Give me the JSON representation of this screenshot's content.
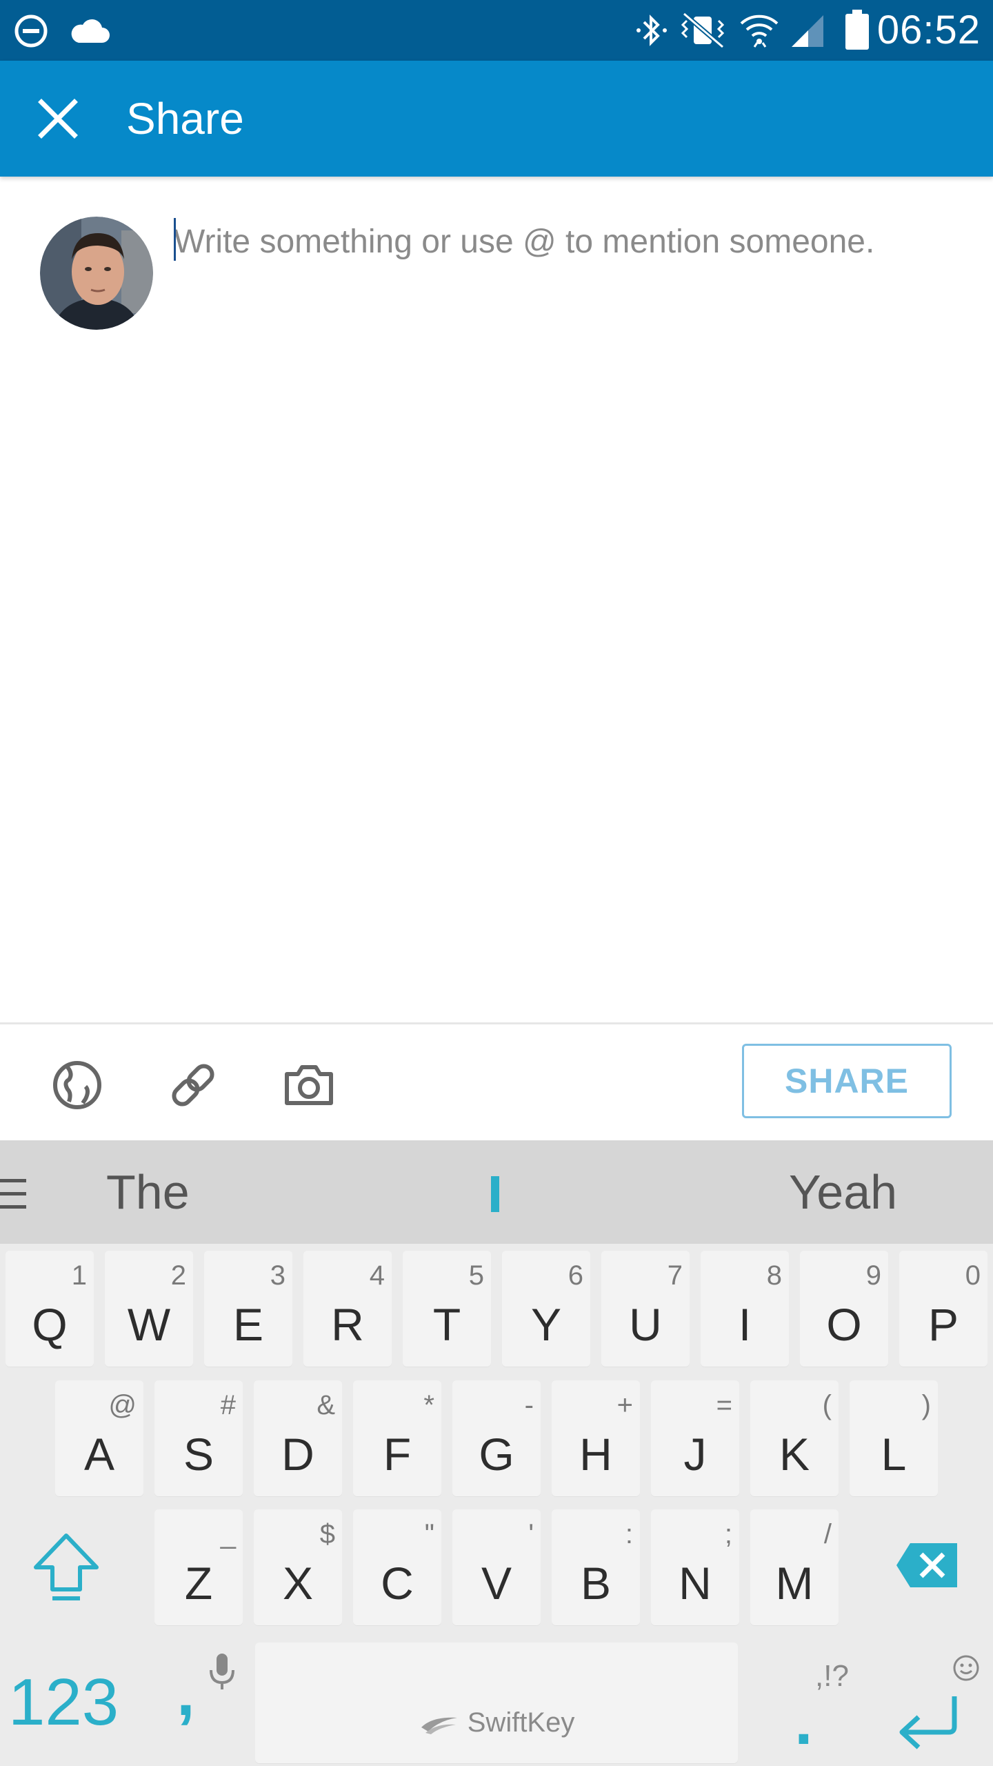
{
  "status_bar": {
    "time": "06:52",
    "left_icons": [
      "do-not-disturb-icon",
      "cloud-icon"
    ],
    "right_icons": [
      "bluetooth-icon",
      "vibrate-mute-icon",
      "wifi-icon",
      "cell-signal-icon",
      "battery-icon"
    ]
  },
  "app_bar": {
    "title": "Share",
    "close_icon": "close-icon",
    "background": "#0689c9"
  },
  "composer": {
    "placeholder": "Write something or use @ to mention someone."
  },
  "toolbar": {
    "icons": [
      "globe-visibility-icon",
      "link-icon",
      "camera-icon"
    ],
    "share_label": "SHARE"
  },
  "keyboard": {
    "suggestions": [
      "The",
      "Yeah"
    ],
    "row1": [
      {
        "main": "Q",
        "sec": "1"
      },
      {
        "main": "W",
        "sec": "2"
      },
      {
        "main": "E",
        "sec": "3"
      },
      {
        "main": "R",
        "sec": "4"
      },
      {
        "main": "T",
        "sec": "5"
      },
      {
        "main": "Y",
        "sec": "6"
      },
      {
        "main": "U",
        "sec": "7"
      },
      {
        "main": "I",
        "sec": "8"
      },
      {
        "main": "O",
        "sec": "9"
      },
      {
        "main": "P",
        "sec": "0"
      }
    ],
    "row2": [
      {
        "main": "A",
        "sec": "@"
      },
      {
        "main": "S",
        "sec": "#"
      },
      {
        "main": "D",
        "sec": "&"
      },
      {
        "main": "F",
        "sec": "*"
      },
      {
        "main": "G",
        "sec": "-"
      },
      {
        "main": "H",
        "sec": "+"
      },
      {
        "main": "J",
        "sec": "="
      },
      {
        "main": "K",
        "sec": "("
      },
      {
        "main": "L",
        "sec": ")"
      }
    ],
    "row3": [
      {
        "main": "Z",
        "sec": "_"
      },
      {
        "main": "X",
        "sec": "$"
      },
      {
        "main": "C",
        "sec": "\""
      },
      {
        "main": "V",
        "sec": "'"
      },
      {
        "main": "B",
        "sec": ":"
      },
      {
        "main": "N",
        "sec": ";"
      },
      {
        "main": "M",
        "sec": "/"
      }
    ],
    "numbers_label": "123",
    "comma": ",",
    "period": ".",
    "punct_hint": ",!?",
    "brand": "SwiftKey",
    "accent": "#2bafc9"
  }
}
